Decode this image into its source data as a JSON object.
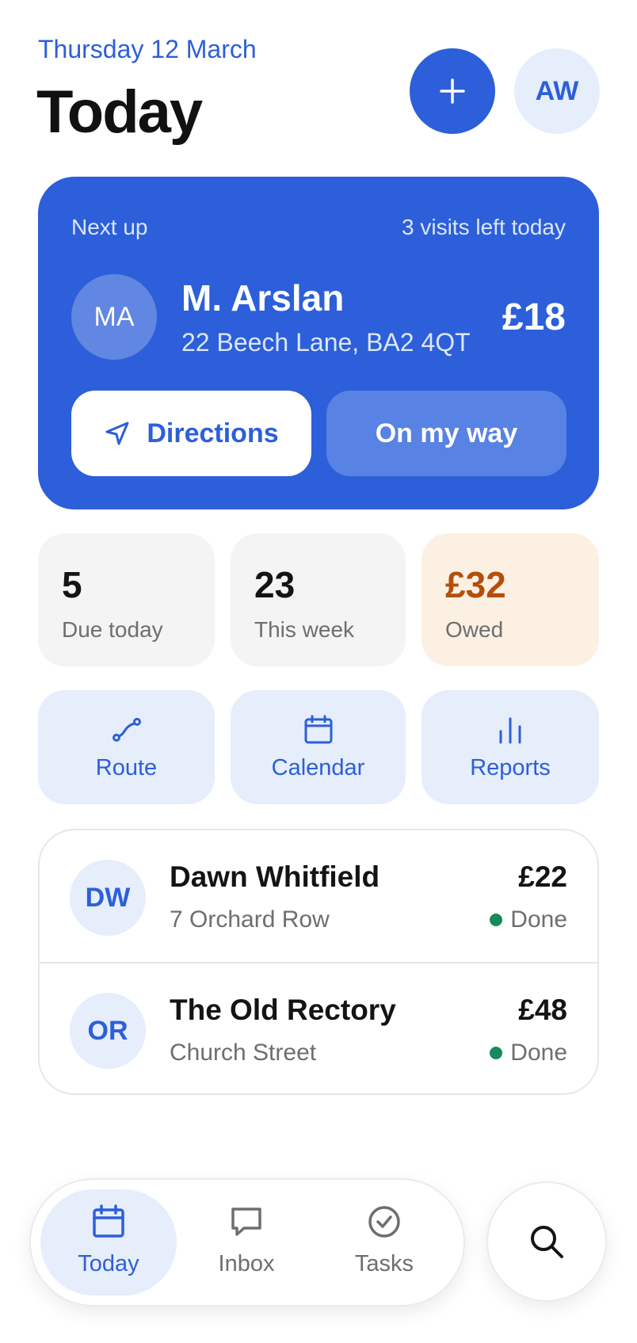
{
  "header": {
    "date": "Thursday 12 March",
    "title": "Today",
    "user_initials": "AW"
  },
  "next_up": {
    "label": "Next up",
    "visits_left": "3 visits left today",
    "initials": "MA",
    "name": "M. Arslan",
    "address": "22 Beech Lane, BA2 4QT",
    "price": "£18",
    "directions_label": "Directions",
    "on_my_way_label": "On my way"
  },
  "stats": [
    {
      "value": "5",
      "label": "Due today"
    },
    {
      "value": "23",
      "label": "This week"
    },
    {
      "value": "£32",
      "label": "Owed"
    }
  ],
  "quick_actions": [
    {
      "label": "Route",
      "icon": "route-icon"
    },
    {
      "label": "Calendar",
      "icon": "calendar-icon"
    },
    {
      "label": "Reports",
      "icon": "bar-chart-icon"
    }
  ],
  "visits": [
    {
      "initials": "DW",
      "name": "Dawn Whitfield",
      "address": "7 Orchard Row",
      "price": "£22",
      "status": "Done"
    },
    {
      "initials": "OR",
      "name": "The Old Rectory",
      "address": "Church Street",
      "price": "£48",
      "status": "Done"
    }
  ],
  "tabbar": {
    "tabs": [
      {
        "label": "Today",
        "icon": "calendar-icon",
        "active": true
      },
      {
        "label": "Inbox",
        "icon": "chat-icon",
        "active": false
      },
      {
        "label": "Tasks",
        "icon": "check-circle-icon",
        "active": false
      }
    ],
    "search_icon": "search-icon"
  },
  "colors": {
    "accent": "#2C5FD9",
    "accent_light": "#E6EDFB",
    "owed_bg": "#FCF0E3",
    "owed_text": "#B34F0B",
    "done_dot": "#178A5B"
  }
}
